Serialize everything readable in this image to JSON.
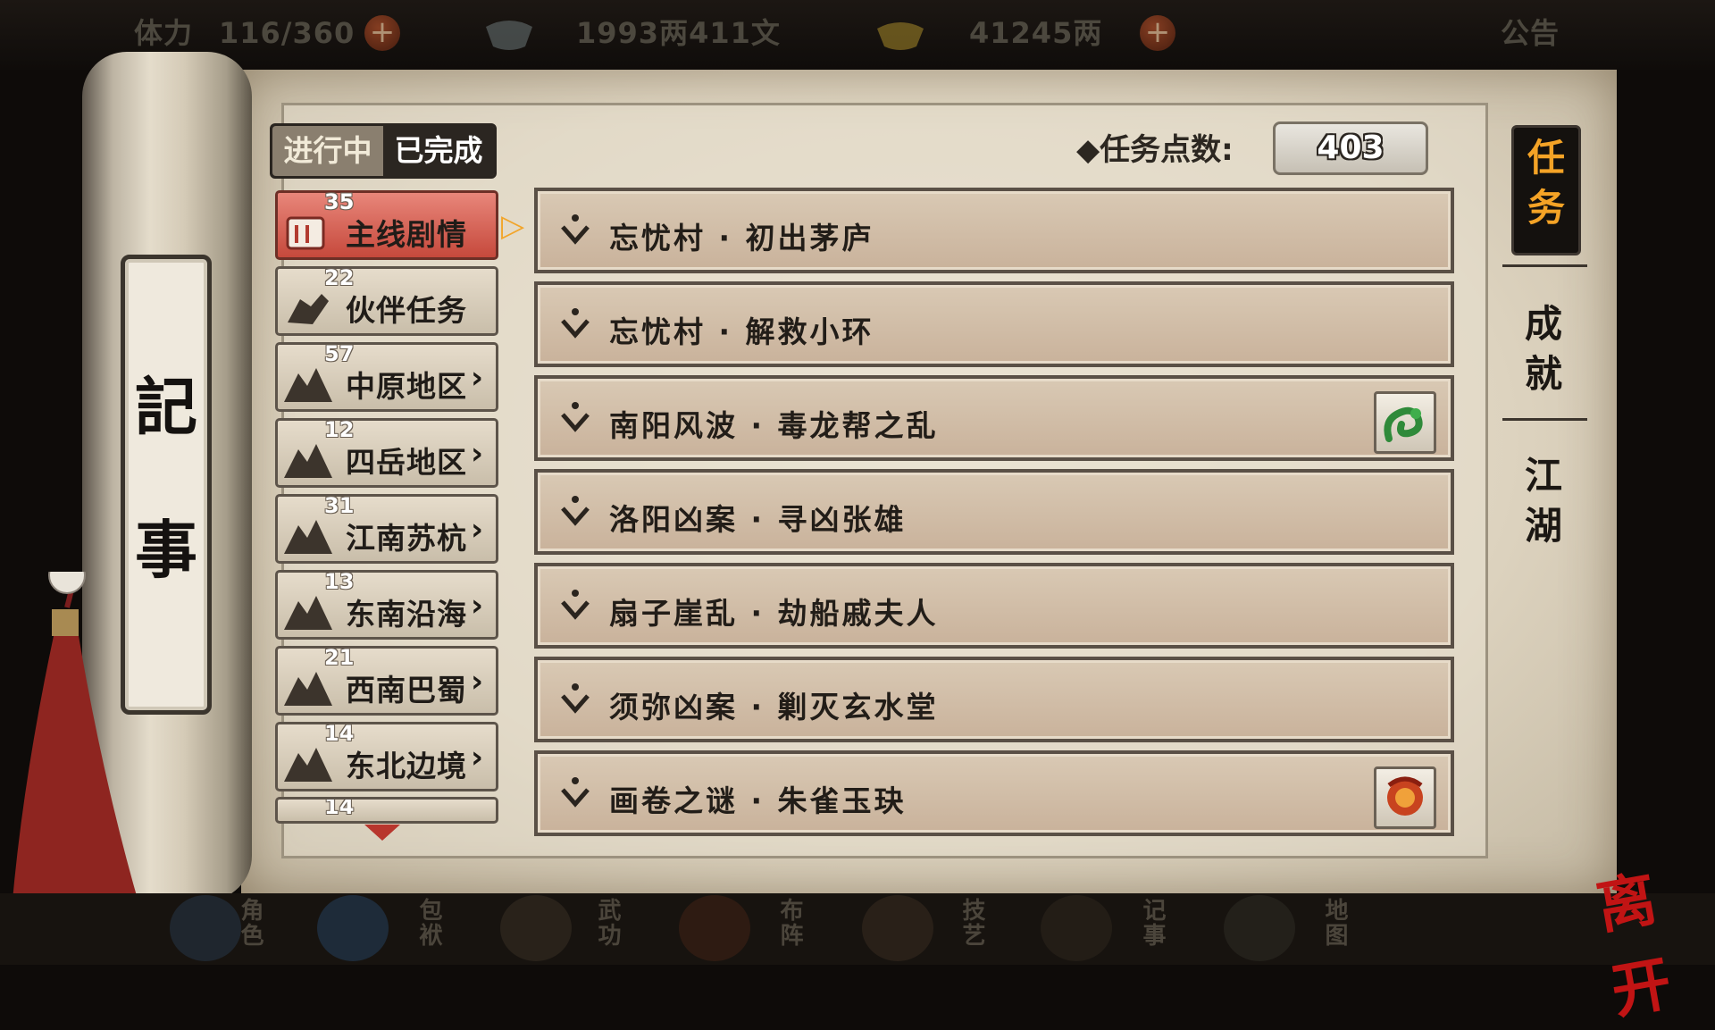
{
  "topbar": {
    "stamina_label": "体力",
    "stamina": "116/360",
    "silver": "1993两411文",
    "gold": "41245两",
    "notice": "公告",
    "plus_glyph": "+"
  },
  "scroll_label": [
    "記",
    "事"
  ],
  "tabs": {
    "in_progress": "进行中",
    "completed": "已完成"
  },
  "points": {
    "label": "◆任务点数:",
    "value": "403"
  },
  "categories": [
    {
      "count": "35",
      "label": "主线剧情",
      "icon": "scroll-icon"
    },
    {
      "count": "22",
      "label": "伙伴任务",
      "icon": "handshake-icon"
    },
    {
      "count": "57",
      "label": "中原地区",
      "icon": "mountain-icon"
    },
    {
      "count": "12",
      "label": "四岳地区",
      "icon": "mountain-icon"
    },
    {
      "count": "31",
      "label": "江南苏杭",
      "icon": "mountain-icon"
    },
    {
      "count": "13",
      "label": "东南沿海",
      "icon": "mountain-icon"
    },
    {
      "count": "21",
      "label": "西南巴蜀",
      "icon": "mountain-icon"
    },
    {
      "count": "14",
      "label": "东北边境",
      "icon": "mountain-icon"
    },
    {
      "count": "14",
      "label": "",
      "icon": "mountain-icon"
    }
  ],
  "arrow_glyph": "›",
  "quests": [
    {
      "title": "忘忧村 · 初出茅庐",
      "reward": ""
    },
    {
      "title": "忘忧村 · 解救小环",
      "reward": ""
    },
    {
      "title": "南阳风波 · 毒龙帮之乱",
      "reward": "green-dragon-icon"
    },
    {
      "title": "洛阳凶案 · 寻凶张雄",
      "reward": ""
    },
    {
      "title": "扇子崖乱 · 劫船戚夫人",
      "reward": ""
    },
    {
      "title": "须弥凶案 · 剿灭玄水堂",
      "reward": ""
    },
    {
      "title": "画卷之谜 · 朱雀玉玦",
      "reward": "red-phoenix-icon"
    }
  ],
  "side_tabs": [
    "任务",
    "成就",
    "江湖"
  ],
  "bottom_nav": [
    "角色",
    "包袱",
    "武功",
    "布阵",
    "技艺",
    "记事",
    "地图"
  ],
  "exit_label": "离开",
  "colors": {
    "selected_category": "#d05a4c",
    "accent_orange": "#f4a326",
    "exit_red": "#c11414"
  }
}
